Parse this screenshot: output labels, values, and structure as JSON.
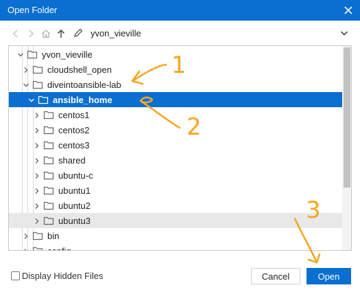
{
  "window": {
    "title": "Open Folder"
  },
  "toolbar": {
    "path": "yvon_vieville"
  },
  "tree": {
    "rows": [
      {
        "label": "yvon_vieville",
        "expanded": true
      },
      {
        "label": "cloudshell_open",
        "expanded": false
      },
      {
        "label": "diveintoansible-lab",
        "expanded": true
      },
      {
        "label": "ansible_home",
        "expanded": true,
        "selected": true
      },
      {
        "label": "centos1",
        "expanded": false
      },
      {
        "label": "centos2",
        "expanded": false
      },
      {
        "label": "centos3",
        "expanded": false
      },
      {
        "label": "shared",
        "expanded": false
      },
      {
        "label": "ubuntu-c",
        "expanded": false
      },
      {
        "label": "ubuntu1",
        "expanded": false
      },
      {
        "label": "ubuntu2",
        "expanded": false
      },
      {
        "label": "ubuntu3",
        "expanded": false,
        "hovered": true
      },
      {
        "label": "bin",
        "expanded": false
      },
      {
        "label": "config",
        "expanded": false
      }
    ]
  },
  "footer": {
    "show_hidden_label": "Display Hidden Files",
    "show_hidden_checked": false,
    "cancel_label": "Cancel",
    "open_label": "Open"
  },
  "annotations": {
    "labels": [
      "1",
      "2",
      "3"
    ]
  },
  "colors": {
    "accent": "#0a6fd0",
    "annotation": "#f5a623"
  }
}
